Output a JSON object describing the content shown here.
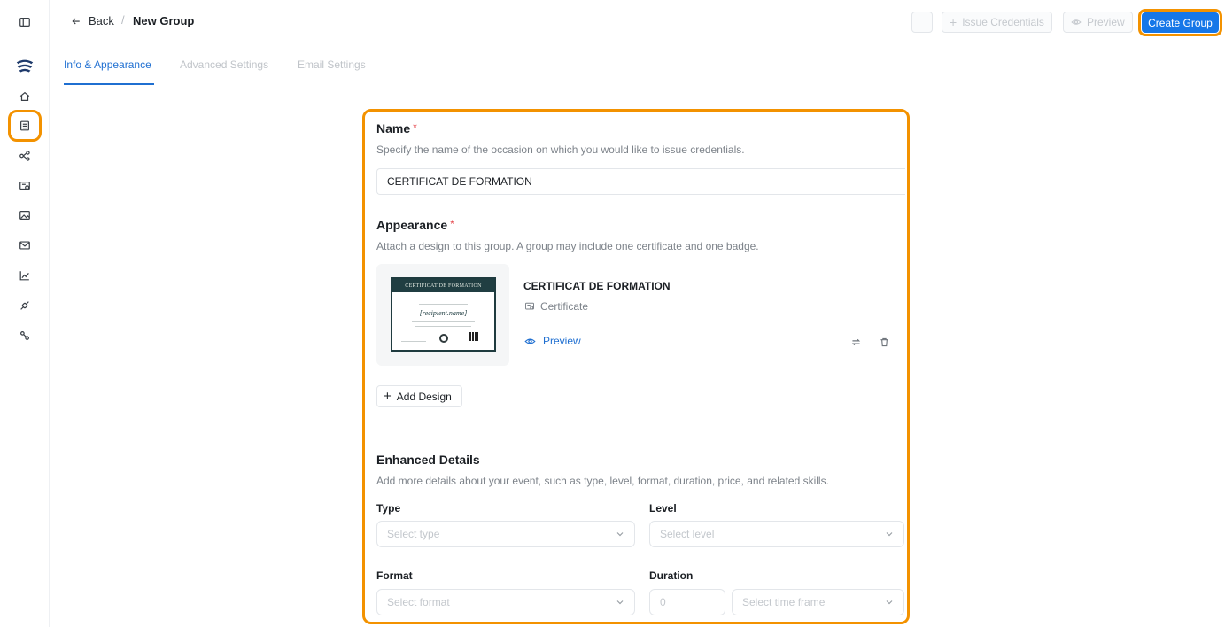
{
  "sidebar": {
    "icons": [
      "sidebar-toggle-icon",
      "logo-icon",
      "home-icon",
      "groups-icon",
      "workflow-icon",
      "designs-icon",
      "image-icon",
      "mail-icon",
      "analytics-icon",
      "integrations-icon",
      "settings-icon"
    ]
  },
  "header": {
    "back_label": "Back",
    "separator": "/",
    "title": "New Group",
    "issue_label": "Issue Credentials",
    "preview_label": "Preview",
    "create_label": "Create Group"
  },
  "tabs": [
    {
      "label": "Info & Appearance",
      "active": true
    },
    {
      "label": "Advanced Settings",
      "active": false
    },
    {
      "label": "Email Settings",
      "active": false
    }
  ],
  "form": {
    "name": {
      "label": "Name",
      "required_mark": "*",
      "help": "Specify the name of the occasion on which you would like to issue credentials.",
      "value": "CERTIFICAT DE FORMATION"
    },
    "appearance": {
      "label": "Appearance",
      "required_mark": "*",
      "help": "Attach a design to this group. A group may include one certificate and one badge.",
      "design": {
        "thumbnail_title": "CERTIFICAT DE FORMATION",
        "thumbnail_name": "[recipient.name]",
        "title": "CERTIFICAT DE FORMATION",
        "type": "Certificate",
        "preview_label": "Preview"
      },
      "add_design_label": "Add Design"
    },
    "enhanced": {
      "label": "Enhanced Details",
      "help": "Add more details about your event, such as type, level, format, duration, price, and related skills.",
      "type_label": "Type",
      "type_placeholder": "Select type",
      "level_label": "Level",
      "level_placeholder": "Select level",
      "format_label": "Format",
      "format_placeholder": "Select format",
      "duration_label": "Duration",
      "duration_value": "0",
      "timeframe_placeholder": "Select time frame"
    }
  },
  "colors": {
    "accent": "#1677e8",
    "highlight": "#f39200",
    "required": "#e5484d"
  }
}
